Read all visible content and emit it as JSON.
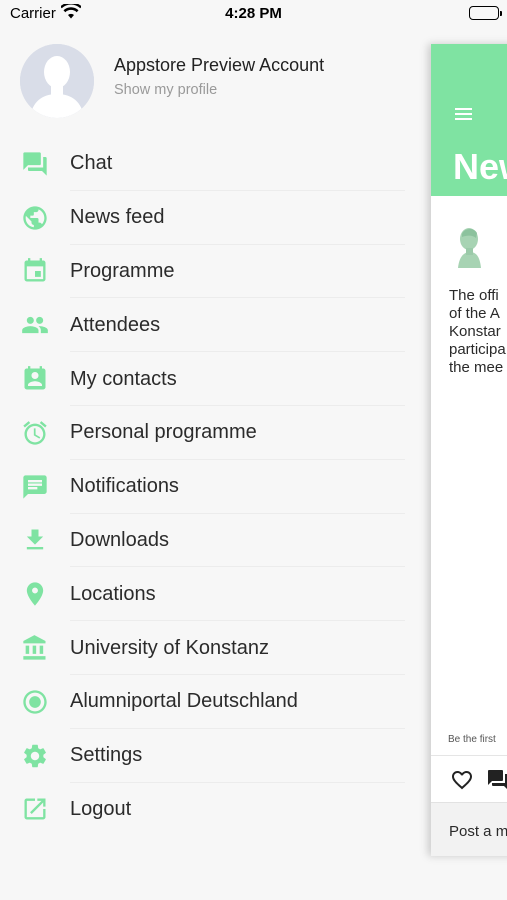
{
  "status_bar": {
    "carrier": "Carrier",
    "time": "4:28 PM"
  },
  "profile": {
    "name": "Appstore Preview Account",
    "link": "Show my profile"
  },
  "accent_color": "#7fe3a2",
  "menu": [
    {
      "label": "Chat",
      "icon": "chat-icon"
    },
    {
      "label": "News feed",
      "icon": "globe-icon"
    },
    {
      "label": "Programme",
      "icon": "calendar-icon"
    },
    {
      "label": "Attendees",
      "icon": "people-icon"
    },
    {
      "label": "My contacts",
      "icon": "contact-book-icon"
    },
    {
      "label": "Personal programme",
      "icon": "alarm-clock-icon"
    },
    {
      "label": "Notifications",
      "icon": "message-icon"
    },
    {
      "label": "Downloads",
      "icon": "download-icon"
    },
    {
      "label": "Locations",
      "icon": "location-pin-icon"
    },
    {
      "label": "University of Konstanz",
      "icon": "institution-icon"
    },
    {
      "label": "Alumniportal Deutschland",
      "icon": "radio-button-icon"
    },
    {
      "label": "Settings",
      "icon": "gear-icon"
    },
    {
      "label": "Logout",
      "icon": "external-link-icon"
    }
  ],
  "main": {
    "title": "New",
    "post_text_lines": [
      "The offi",
      "of the A",
      "Konstar",
      "participa",
      "the mee"
    ],
    "be_first": "Be the first",
    "post_prompt": "Post a m"
  }
}
